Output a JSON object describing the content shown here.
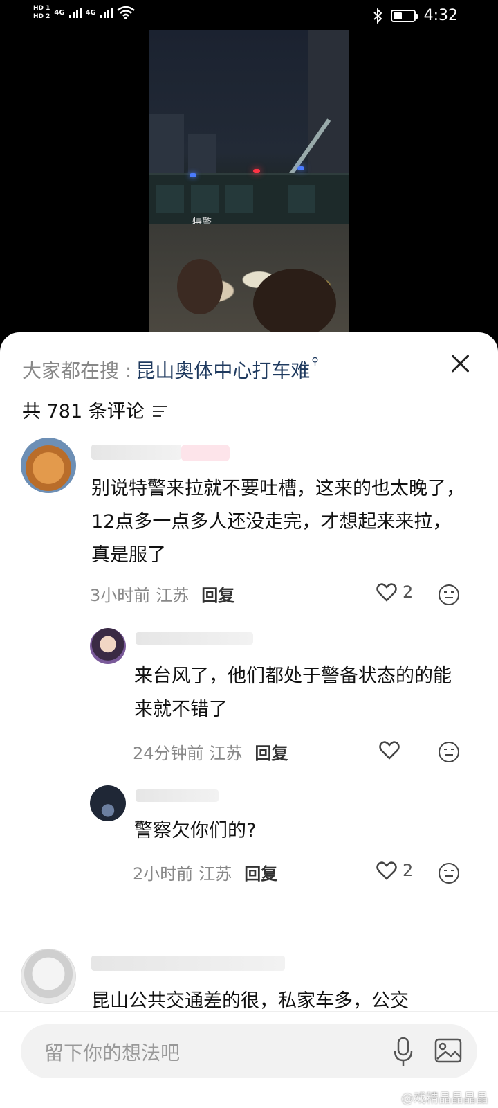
{
  "status_bar": {
    "hd1": "HD 1",
    "hd2": "HD 2",
    "net1": "4G",
    "net2": "4G",
    "time": "4:32",
    "battery_level": 0.45
  },
  "sheet": {
    "search_prefix": "大家都在搜 :",
    "search_term": "昆山奥体中心打车难",
    "comment_count": "共 781 条评论"
  },
  "comments": [
    {
      "text": "别说特警来拉就不要吐槽，这来的也太晚了，12点多一点多人还没走完，才想起来来拉，真是服了",
      "time": "3小时前",
      "location": "江苏",
      "reply_label": "回复",
      "likes": "2"
    },
    {
      "text": "来台风了，他们都处于警备状态的的能来就不错了",
      "time": "24分钟前",
      "location": "江苏",
      "reply_label": "回复",
      "likes": ""
    },
    {
      "text": "警察欠你们的?",
      "time": "2小时前",
      "location": "江苏",
      "reply_label": "回复",
      "likes": "2"
    },
    {
      "text": "昆山公共交通差的很，私家车多，公交",
      "time": "",
      "location": "",
      "reply_label": "",
      "likes": ""
    }
  ],
  "input": {
    "placeholder": "留下你的想法吧"
  },
  "video": {
    "bus_label": "特警"
  },
  "watermark": "@戏精晶晶晶晶",
  "colors": {
    "search_term": "#1f3a5f",
    "author_badge": "#fde4ea",
    "meta_text": "#888888"
  }
}
